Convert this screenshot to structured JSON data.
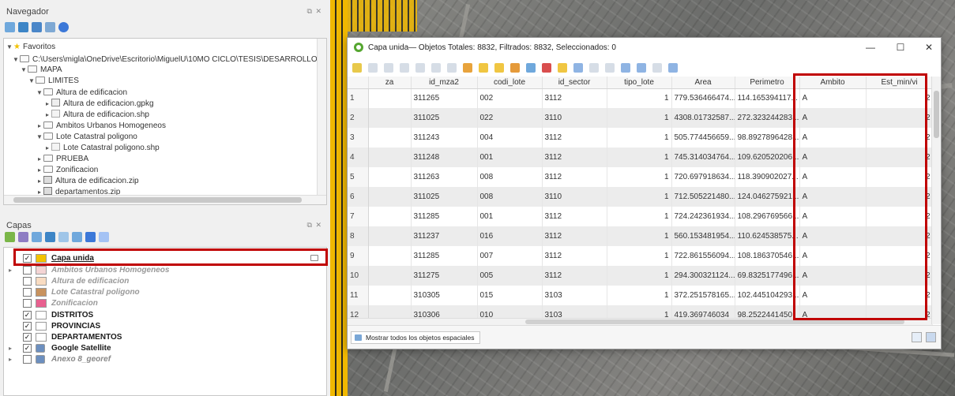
{
  "navigator": {
    "title": "Navegador",
    "items": [
      {
        "label": "Favoritos"
      },
      {
        "label": "C:\\Users\\migla\\OneDrive\\Escritorio\\MiguelU\\10MO CICLO\\TESIS\\DESARROLLO"
      },
      {
        "label": "MAPA"
      },
      {
        "label": "LIMITES"
      },
      {
        "label": "Altura de edificacion"
      },
      {
        "label": "Altura de edificacion.gpkg"
      },
      {
        "label": "Altura de edificacion.shp"
      },
      {
        "label": "Ambitos Urbanos Homogeneos"
      },
      {
        "label": "Lote Catastral poligono"
      },
      {
        "label": "Lote Catastral poligono.shp"
      },
      {
        "label": "PRUEBA"
      },
      {
        "label": "Zonificacion"
      },
      {
        "label": "Altura de edificacion.zip"
      },
      {
        "label": "departamentos.zip"
      }
    ]
  },
  "layers": {
    "title": "Capas",
    "items": [
      {
        "label": "Capa unida",
        "checked": "✓",
        "color": "#f2c200"
      },
      {
        "label": "Ambitos Urbanos Homogeneos",
        "checked": "",
        "color": "#f4d4d4"
      },
      {
        "label": "Altura de edificacion",
        "checked": "",
        "color": "#f9dcc2"
      },
      {
        "label": "Lote Catastral poligono",
        "checked": "",
        "color": "#c8925e"
      },
      {
        "label": "Zonificacion",
        "checked": "",
        "color": "#e8608f"
      },
      {
        "label": "DISTRITOS",
        "checked": "✓",
        "color": "#ffffff"
      },
      {
        "label": "PROVINCIAS",
        "checked": "✓",
        "color": "#ffffff"
      },
      {
        "label": "DEPARTAMENTOS",
        "checked": "✓",
        "color": "#ffffff"
      },
      {
        "label": "Google Satellite",
        "checked": "✓",
        "color": "#6c8fbf"
      },
      {
        "label": "Anexo 8_georef",
        "checked": "",
        "color": "#6c8fbf"
      }
    ]
  },
  "attribute_table": {
    "title": "Capa unida— Objetos Totales: 8832, Filtrados: 8832, Seleccionados: 0",
    "columns": [
      "za",
      "id_mza2",
      "codi_lote",
      "id_sector",
      "tipo_lote",
      "Area",
      "Perimetro",
      "Ambito",
      "Est_min/vi"
    ],
    "rows": [
      {
        "n": "1",
        "za": "",
        "id_mza2": "311265",
        "codi_lote": "002",
        "id_sector": "3112",
        "tipo_lote": "1",
        "area": "779.536466474...",
        "perimetro": "114.165394117...",
        "ambito": "A",
        "est": "2"
      },
      {
        "n": "2",
        "za": "",
        "id_mza2": "311025",
        "codi_lote": "022",
        "id_sector": "3110",
        "tipo_lote": "1",
        "area": "4308.01732587...",
        "perimetro": "272.323244283...",
        "ambito": "A",
        "est": "2"
      },
      {
        "n": "3",
        "za": "",
        "id_mza2": "311243",
        "codi_lote": "004",
        "id_sector": "3112",
        "tipo_lote": "1",
        "area": "505.774456659...",
        "perimetro": "98.8927896428...",
        "ambito": "A",
        "est": "2"
      },
      {
        "n": "4",
        "za": "",
        "id_mza2": "311248",
        "codi_lote": "001",
        "id_sector": "3112",
        "tipo_lote": "1",
        "area": "745.314034764...",
        "perimetro": "109.620520206...",
        "ambito": "A",
        "est": "2"
      },
      {
        "n": "5",
        "za": "",
        "id_mza2": "311263",
        "codi_lote": "008",
        "id_sector": "3112",
        "tipo_lote": "1",
        "area": "720.697918634...",
        "perimetro": "118.390902027...",
        "ambito": "A",
        "est": "2"
      },
      {
        "n": "6",
        "za": "",
        "id_mza2": "311025",
        "codi_lote": "008",
        "id_sector": "3110",
        "tipo_lote": "1",
        "area": "712.505221480...",
        "perimetro": "124.046275921...",
        "ambito": "A",
        "est": "2"
      },
      {
        "n": "7",
        "za": "",
        "id_mza2": "311285",
        "codi_lote": "001",
        "id_sector": "3112",
        "tipo_lote": "1",
        "area": "724.242361934...",
        "perimetro": "108.296769566...",
        "ambito": "A",
        "est": "2"
      },
      {
        "n": "8",
        "za": "",
        "id_mza2": "311237",
        "codi_lote": "016",
        "id_sector": "3112",
        "tipo_lote": "1",
        "area": "560.153481954...",
        "perimetro": "110.624538575...",
        "ambito": "A",
        "est": "2"
      },
      {
        "n": "9",
        "za": "",
        "id_mza2": "311285",
        "codi_lote": "007",
        "id_sector": "3112",
        "tipo_lote": "1",
        "area": "722.861556094...",
        "perimetro": "108.186370546...",
        "ambito": "A",
        "est": "2"
      },
      {
        "n": "10",
        "za": "",
        "id_mza2": "311275",
        "codi_lote": "005",
        "id_sector": "3112",
        "tipo_lote": "1",
        "area": "294.300321124...",
        "perimetro": "69.8325177496...",
        "ambito": "A",
        "est": "2"
      },
      {
        "n": "11",
        "za": "",
        "id_mza2": "310305",
        "codi_lote": "015",
        "id_sector": "3103",
        "tipo_lote": "1",
        "area": "372.251578165...",
        "perimetro": "102.445104293...",
        "ambito": "A",
        "est": "2"
      },
      {
        "n": "12",
        "za": "",
        "id_mza2": "310306",
        "codi_lote": "010",
        "id_sector": "3103",
        "tipo_lote": "1",
        "area": "419.369746034",
        "perimetro": "98.2522441450",
        "ambito": "A",
        "est": "2"
      }
    ],
    "footer_button": "Mostrar todos los objetos espaciales"
  },
  "colors": {
    "highlight": "#c00000",
    "accent_yellow": "#f2c200",
    "qgis_green": "#55a630"
  }
}
